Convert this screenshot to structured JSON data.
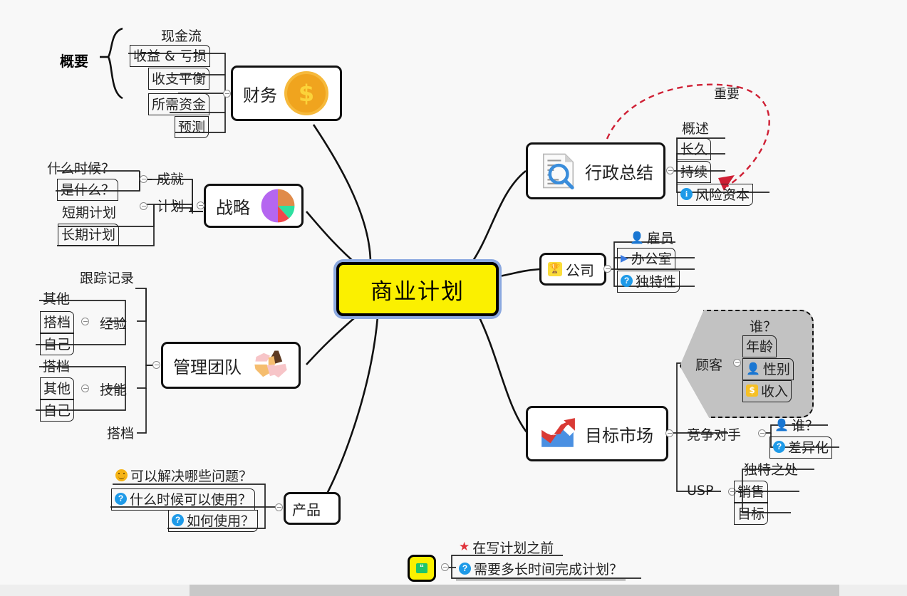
{
  "app": {
    "background": "#f8f8f8",
    "scrollbar_color": "#c8c8c8"
  },
  "root": {
    "label": "商业计划",
    "fill": "#fbf000",
    "glow": "#8ca9e0"
  },
  "branches": {
    "finance": {
      "label": "财务",
      "icon": "dollar-coin-icon",
      "boundary_label": "概要",
      "children": [
        "现金流",
        "收益 & 亏损",
        "收支平衡",
        "所需资金",
        "预测"
      ]
    },
    "strategy": {
      "label": "战略",
      "icon": "pie-chart-icon",
      "children": [
        {
          "label": "成就",
          "items": [
            "什么时候？",
            "是什么？"
          ]
        },
        {
          "label": "计划",
          "items": [
            "短期计划",
            "长期计划"
          ]
        }
      ]
    },
    "management": {
      "label": "管理团队",
      "icon": "handshake-icon",
      "children": [
        {
          "label": "经验",
          "items": [
            "跟踪记录",
            "其他",
            "搭档",
            "自己"
          ]
        },
        {
          "label": "技能",
          "items": [
            "搭档",
            "其他",
            "自己",
            "搭档"
          ]
        }
      ]
    },
    "product": {
      "label": "产品",
      "children": [
        {
          "label": "可以解决哪些问题？",
          "icon": "smiley-icon"
        },
        {
          "label": "什么时候可以使用？",
          "icon": "question-icon"
        },
        {
          "label": "如何使用？",
          "icon": "question-icon"
        }
      ]
    },
    "executive_summary": {
      "label": "行政总结",
      "icon": "document-search-icon",
      "children": [
        {
          "label": "概述",
          "icon": ""
        },
        {
          "label": "长久",
          "icon": ""
        },
        {
          "label": "持续",
          "icon": ""
        },
        {
          "label": "风险资本",
          "icon": "info-icon"
        }
      ],
      "relation_label": "重要",
      "relation_color": "#cf1f34"
    },
    "company": {
      "label": "公司",
      "icon": "trophy-icon",
      "children": [
        {
          "label": "雇员",
          "icon": "person-icon"
        },
        {
          "label": "办公室",
          "icon": "flag-icon"
        },
        {
          "label": "独特性",
          "icon": "question-icon"
        }
      ]
    },
    "target_market": {
      "label": "目标市场",
      "icon": "growth-chart-icon",
      "children": [
        {
          "label": "顾客",
          "highlighted": true,
          "items": [
            {
              "label": "谁？",
              "icon": ""
            },
            {
              "label": "年龄",
              "icon": ""
            },
            {
              "label": "性别",
              "icon": "person-icon"
            },
            {
              "label": "收入",
              "icon": "dollar-square-icon"
            }
          ]
        },
        {
          "label": "竞争对手",
          "items": [
            {
              "label": "谁？",
              "icon": "person-gray-icon"
            },
            {
              "label": "差异化",
              "icon": "question-icon"
            }
          ]
        },
        {
          "label": "USP",
          "items": [
            {
              "label": "独特之处",
              "icon": ""
            },
            {
              "label": "销售",
              "icon": ""
            },
            {
              "label": "目标",
              "icon": ""
            }
          ]
        }
      ]
    },
    "note": {
      "icon": "quote-icon",
      "children": [
        {
          "label": "在写计划之前",
          "icon": "star-icon"
        },
        {
          "label": "需要多长时间完成计划？",
          "icon": "question-icon"
        }
      ]
    }
  },
  "palette": {
    "pie": [
      "#b566f0",
      "#e08b4a",
      "#2ee0a0",
      "#f0484a"
    ],
    "coin": "#f0a41e",
    "info_blue": "#1e9ae8",
    "accent_red": "#cf1f34"
  }
}
